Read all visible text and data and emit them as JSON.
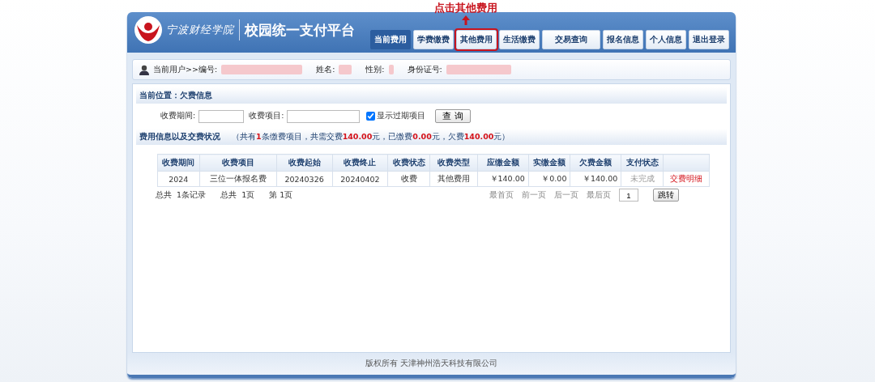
{
  "annotation": {
    "text": "点击其他费用"
  },
  "header": {
    "logo_text": "宁波财经学院",
    "title": "校园统一支付平台"
  },
  "nav": [
    {
      "label": "当前费用",
      "selected": true,
      "highlighted": false
    },
    {
      "label": "学费缴费",
      "selected": false,
      "highlighted": false
    },
    {
      "label": "其他费用",
      "selected": false,
      "highlighted": true
    },
    {
      "label": "生活缴费",
      "selected": false,
      "highlighted": false
    },
    {
      "label": "交易查询",
      "selected": false,
      "highlighted": false
    },
    {
      "label": "报名信息",
      "selected": false,
      "highlighted": false
    },
    {
      "label": "个人信息",
      "selected": false,
      "highlighted": false
    },
    {
      "label": "退出登录",
      "selected": false,
      "highlighted": false
    }
  ],
  "user_bar": {
    "prefix": "当前用户>>编号:",
    "name_label": "姓名:",
    "gender_label": "性别:",
    "id_label": "身份证号:"
  },
  "location": "当前位置：欠费信息",
  "filters": {
    "period_label": "收费期间:",
    "item_label": "收费项目:",
    "show_expired": {
      "label": "显示过期项目",
      "checked": true
    },
    "query_button": "查 询"
  },
  "summary": {
    "title": "费用信息以及交费状况",
    "detail": "（共有**1**条缴费项目，共需交费**140.00**元，已缴费**0.00**元，欠费**140.00**元）"
  },
  "table": {
    "columns": [
      "收费期间",
      "收费项目",
      "收费起始",
      "收费终止",
      "收费状态",
      "收费类型",
      "应缴金额",
      "实缴金额",
      "欠费金额",
      "支付状态"
    ],
    "rows": [
      {
        "cells": [
          "2024",
          "三位一体报名费",
          "20240326",
          "20240402",
          "收费",
          "其他费用",
          "￥140.00",
          "￥0.00",
          "￥140.00",
          "未完成"
        ],
        "link": "交费明细"
      }
    ]
  },
  "pagination": {
    "total_records": "总共  1条记录",
    "total_pages": "总共  1页",
    "current_page": "第 1页",
    "first": "最首页",
    "prev": "前一页",
    "next": "后一页",
    "last": "最后页",
    "page_input": "1",
    "jump": "跳转"
  },
  "footer": "版权所有 天津神州浩天科技有限公司"
}
